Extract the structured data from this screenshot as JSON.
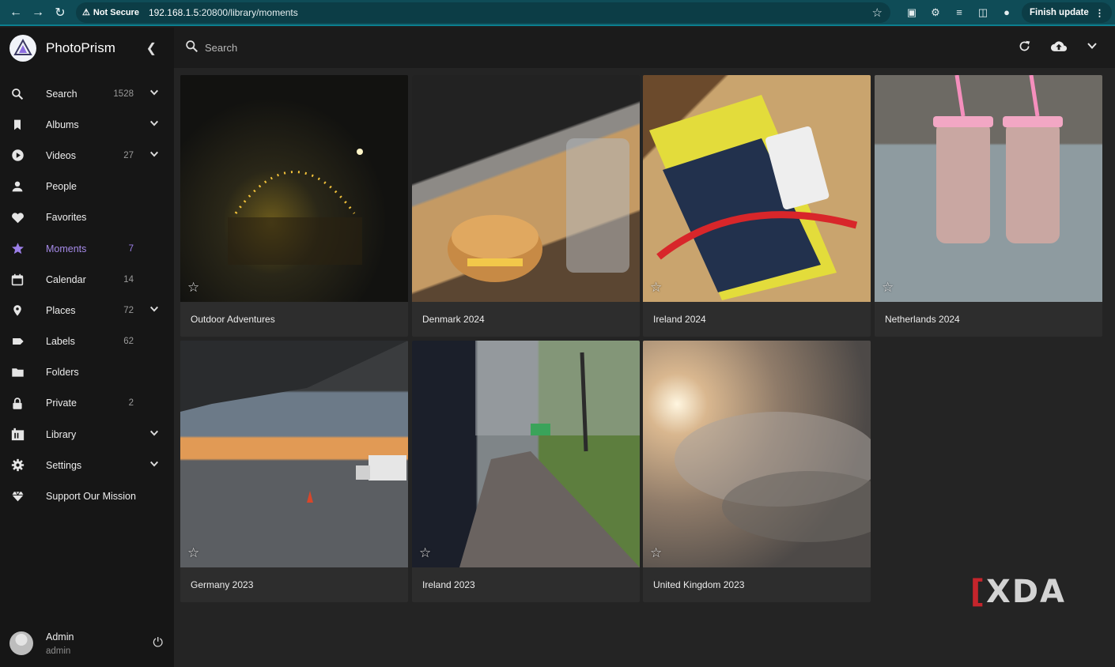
{
  "browser": {
    "security_label": "Not Secure",
    "url_host": "192.168.1.5",
    "url_rest": ":20800/library/moments",
    "update_label": "Finish update"
  },
  "app": {
    "name": "PhotoPrism"
  },
  "sidebar": {
    "items": [
      {
        "label": "Search",
        "count": "1528",
        "icon": "search-icon",
        "expand": true
      },
      {
        "label": "Albums",
        "count": "",
        "icon": "bookmark-icon",
        "expand": true
      },
      {
        "label": "Videos",
        "count": "27",
        "icon": "play-circle-icon",
        "expand": true
      },
      {
        "label": "People",
        "count": "",
        "icon": "person-icon",
        "expand": false
      },
      {
        "label": "Favorites",
        "count": "",
        "icon": "heart-icon",
        "expand": false
      },
      {
        "label": "Moments",
        "count": "7",
        "icon": "star-icon",
        "expand": false,
        "active": true
      },
      {
        "label": "Calendar",
        "count": "14",
        "icon": "calendar-icon",
        "expand": false
      },
      {
        "label": "Places",
        "count": "72",
        "icon": "map-pin-icon",
        "expand": true
      },
      {
        "label": "Labels",
        "count": "62",
        "icon": "label-icon",
        "expand": false
      },
      {
        "label": "Folders",
        "count": "",
        "icon": "folder-icon",
        "expand": false
      },
      {
        "label": "Private",
        "count": "2",
        "icon": "lock-icon",
        "expand": false
      },
      {
        "label": "Library",
        "count": "",
        "icon": "library-icon",
        "expand": true
      },
      {
        "label": "Settings",
        "count": "",
        "icon": "gear-icon",
        "expand": true
      },
      {
        "label": "Support Our Mission",
        "count": "",
        "icon": "diamond-icon",
        "expand": false
      }
    ],
    "user": {
      "name": "Admin",
      "role": "admin"
    }
  },
  "search": {
    "placeholder": "Search"
  },
  "moments": [
    {
      "title": "Outdoor Adventures"
    },
    {
      "title": "Denmark 2024"
    },
    {
      "title": "Ireland 2024"
    },
    {
      "title": "Netherlands 2024"
    },
    {
      "title": "Germany 2023"
    },
    {
      "title": "Ireland 2023"
    },
    {
      "title": "United Kingdom 2023"
    }
  ],
  "watermark": "XDA",
  "colors": {
    "accent": "#9c7fe8",
    "chrome": "#0f4c57"
  }
}
